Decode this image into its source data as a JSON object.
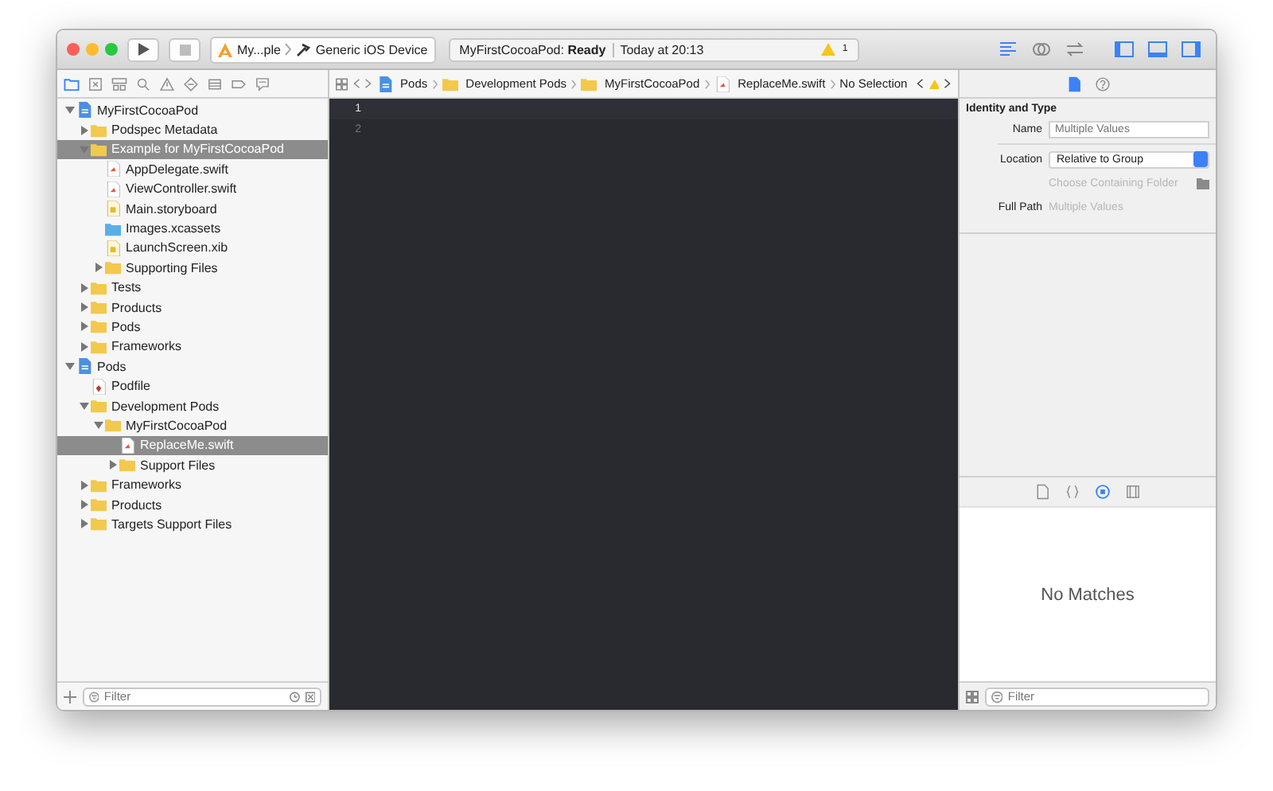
{
  "toolbar": {
    "scheme": {
      "target": "My...ple",
      "device": "Generic iOS Device"
    },
    "activity": {
      "project": "MyFirstCocoaPod:",
      "status": "Ready",
      "time": "Today at 20:13",
      "warnings": "1"
    },
    "editor_modes": [
      {
        "kind": "standard",
        "selected": true
      },
      {
        "kind": "assistant",
        "selected": false
      },
      {
        "kind": "version",
        "selected": false
      }
    ],
    "view_toggles": [
      {
        "kind": "left",
        "selected": true
      },
      {
        "kind": "bottom",
        "selected": true
      },
      {
        "kind": "right",
        "selected": true
      }
    ]
  },
  "navigator": {
    "tabs": [
      {
        "kind": "folder",
        "selected": true
      },
      {
        "kind": "source",
        "selected": false
      },
      {
        "kind": "symbol",
        "selected": false
      },
      {
        "kind": "search",
        "selected": false
      },
      {
        "kind": "issue",
        "selected": false
      },
      {
        "kind": "test",
        "selected": false
      },
      {
        "kind": "debug",
        "selected": false
      },
      {
        "kind": "breakpoint",
        "selected": false
      },
      {
        "kind": "report",
        "selected": false
      }
    ],
    "tree": [
      {
        "label": "MyFirstCocoaPod",
        "kind": "project",
        "expanded": true,
        "selected": false,
        "children": [
          {
            "label": "Podspec Metadata",
            "kind": "folder",
            "expanded": false,
            "selected": false
          },
          {
            "label": "Example for MyFirstCocoaPod",
            "kind": "folder",
            "expanded": true,
            "selected": true,
            "children": [
              {
                "label": "AppDelegate.swift",
                "kind": "swift",
                "selected": false
              },
              {
                "label": "ViewController.swift",
                "kind": "swift",
                "selected": false
              },
              {
                "label": "Main.storyboard",
                "kind": "storyboard",
                "selected": false
              },
              {
                "label": "Images.xcassets",
                "kind": "assets",
                "selected": false
              },
              {
                "label": "LaunchScreen.xib",
                "kind": "storyboard",
                "selected": false
              },
              {
                "label": "Supporting Files",
                "kind": "folder",
                "expanded": false,
                "selected": false
              }
            ]
          },
          {
            "label": "Tests",
            "kind": "folder",
            "expanded": false,
            "selected": false
          },
          {
            "label": "Products",
            "kind": "folder",
            "expanded": false,
            "selected": false
          },
          {
            "label": "Pods",
            "kind": "folder",
            "expanded": false,
            "selected": false
          },
          {
            "label": "Frameworks",
            "kind": "folder",
            "expanded": false,
            "selected": false
          }
        ]
      },
      {
        "label": "Pods",
        "kind": "project",
        "expanded": true,
        "selected": false,
        "children": [
          {
            "label": "Podfile",
            "kind": "ruby",
            "selected": false
          },
          {
            "label": "Development Pods",
            "kind": "folder",
            "expanded": true,
            "selected": false,
            "children": [
              {
                "label": "MyFirstCocoaPod",
                "kind": "folder",
                "expanded": true,
                "selected": false,
                "children": [
                  {
                    "label": "ReplaceMe.swift",
                    "kind": "swift",
                    "selected": true
                  },
                  {
                    "label": "Support Files",
                    "kind": "folder",
                    "expanded": false,
                    "selected": false
                  }
                ]
              }
            ]
          },
          {
            "label": "Frameworks",
            "kind": "folder",
            "expanded": false,
            "selected": false
          },
          {
            "label": "Products",
            "kind": "folder",
            "expanded": false,
            "selected": false
          },
          {
            "label": "Targets Support Files",
            "kind": "folder",
            "expanded": false,
            "selected": false
          }
        ]
      }
    ],
    "filter": {
      "placeholder": "Filter"
    }
  },
  "jump_bar": {
    "path": [
      {
        "label": "Pods",
        "kind": "project"
      },
      {
        "label": "Development Pods",
        "kind": "folder"
      },
      {
        "label": "MyFirstCocoaPod",
        "kind": "folder"
      },
      {
        "label": "ReplaceMe.swift",
        "kind": "swift"
      },
      {
        "label": "No Selection",
        "kind": "text"
      }
    ]
  },
  "editor": {
    "lines": [
      {
        "number": "1",
        "selected": true
      },
      {
        "number": "2",
        "selected": false
      }
    ]
  },
  "inspector": {
    "tabs": [
      {
        "kind": "file",
        "selected": true
      },
      {
        "kind": "help",
        "selected": false
      }
    ],
    "section_title": "Identity and Type",
    "name": {
      "label": "Name",
      "placeholder": "Multiple Values"
    },
    "location": {
      "label": "Location",
      "value": "Relative to Group"
    },
    "choose_folder": {
      "label": "Choose Containing Folder",
      "disabled": true
    },
    "full_path": {
      "label": "Full Path",
      "value": "Multiple Values"
    },
    "library_tabs": [
      {
        "kind": "file",
        "selected": false
      },
      {
        "kind": "braces",
        "selected": false
      },
      {
        "kind": "object",
        "selected": true
      },
      {
        "kind": "media",
        "selected": false
      }
    ],
    "library_empty": "No Matches",
    "filter": {
      "placeholder": "Filter"
    }
  }
}
